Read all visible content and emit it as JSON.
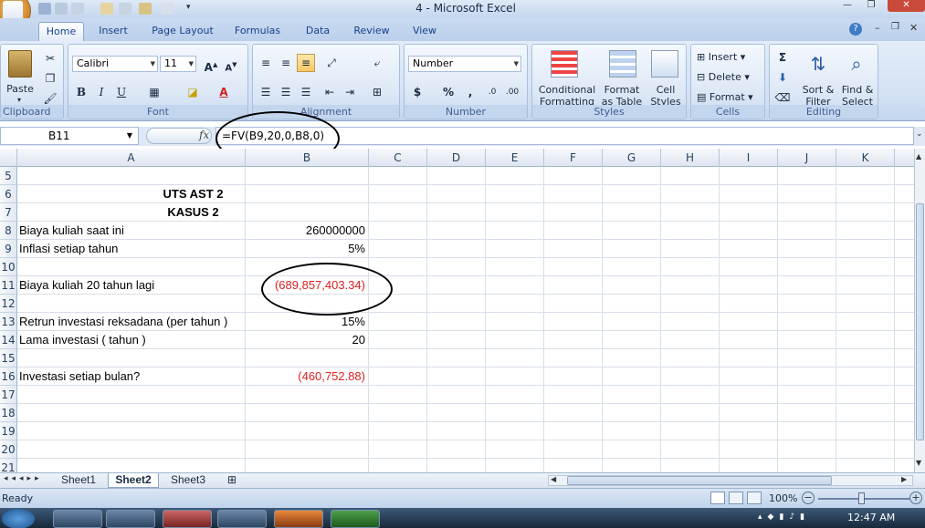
{
  "window": {
    "title": "4 - Microsoft Excel"
  },
  "ribbon": {
    "tabs": [
      "Home",
      "Insert",
      "Page Layout",
      "Formulas",
      "Data",
      "Review",
      "View"
    ],
    "clipboard": {
      "paste_label": "Paste",
      "group_label": "Clipboard"
    },
    "font": {
      "name": "Calibri",
      "size": "11",
      "group_label": "Font"
    },
    "alignment": {
      "group_label": "Alignment"
    },
    "number": {
      "format": "Number",
      "group_label": "Number"
    },
    "styles": {
      "conditional_line1": "Conditional",
      "conditional_line2": "Formatting",
      "format_table_line1": "Format",
      "format_table_line2": "as Table",
      "cell_styles_line1": "Cell",
      "cell_styles_line2": "Styles",
      "group_label": "Styles"
    },
    "cells": {
      "insert": "Insert",
      "delete": "Delete",
      "format": "Format",
      "group_label": "Cells"
    },
    "editing": {
      "sort_line1": "Sort &",
      "sort_line2": "Filter",
      "find_line1": "Find &",
      "find_line2": "Select",
      "group_label": "Editing"
    }
  },
  "formula_bar": {
    "name_box": "B11",
    "fx": "fx",
    "formula": "=FV(B9,20,0,B8,0)"
  },
  "columns": [
    "A",
    "B",
    "C",
    "D",
    "E",
    "F",
    "G",
    "H",
    "I",
    "J",
    "K"
  ],
  "rows": [
    "5",
    "6",
    "7",
    "8",
    "9",
    "10",
    "11",
    "12",
    "13",
    "14",
    "15",
    "16",
    "17",
    "18",
    "19",
    "20",
    "21"
  ],
  "cells": {
    "A6": "UTS AST 2",
    "A7": "KASUS 2",
    "A8": "Biaya kuliah saat ini",
    "B8": "260000000",
    "A9": "Inflasi setiap tahun",
    "B9": "5%",
    "A11": "Biaya kuliah 20 tahun lagi",
    "B11": "(689,857,403.34)",
    "A13": "Retrun investasi reksadana (per tahun )",
    "B13": "15%",
    "A14": "Lama investasi ( tahun )",
    "B14": "20",
    "A16": "Investasi setiap bulan?",
    "B16": "(460,752.88)"
  },
  "sheets": [
    "Sheet1",
    "Sheet2",
    "Sheet3"
  ],
  "active_sheet": "Sheet2",
  "status": {
    "mode": "Ready",
    "zoom": "100%"
  },
  "taskbar": {
    "clock": "12:47 AM"
  },
  "colors": {
    "negative": "#e02020",
    "ribbon_text": "#15428b"
  }
}
